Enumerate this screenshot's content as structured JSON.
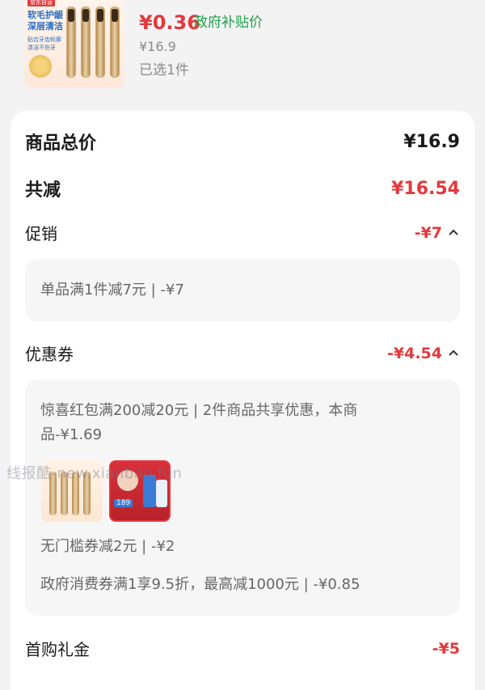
{
  "product": {
    "thumb_brand": "京东自营",
    "thumb_title": "软毛护龈 深层清洁",
    "thumb_subtitle": "贴合牙齿轮廓 清洁不伤牙",
    "price": "¥0.36",
    "subsidy_label": "政府补贴价",
    "original_price": "¥16.9",
    "selected_count": "已选1件"
  },
  "summary": {
    "total_label": "商品总价",
    "total_value": "¥16.9",
    "reduce_label": "共减",
    "reduce_value": "¥16.54",
    "promo_label": "促销",
    "promo_value": "-¥7",
    "promo_detail": "单品满1件减7元 | -¥7",
    "coupon_label": "优惠券",
    "coupon_value": "-¥4.54",
    "coupon_detail_1": "惊喜红包满200减20元 | 2件商品共享优惠，本商",
    "coupon_detail_1b": "品-¥1.69",
    "coupon_detail_2": "无门槛券减2元 | -¥2",
    "coupon_detail_3": "政府消费券满1享9.5折，最高减1000元 | -¥0.85",
    "gift_label": "首购礼金",
    "gift_value": "-¥5"
  },
  "mini_b_tag": "189",
  "watermark": "线报酷-new.xianbao.fun",
  "colors": {
    "accent_red": "#e4393c",
    "subsidy_green": "#21a04a"
  }
}
